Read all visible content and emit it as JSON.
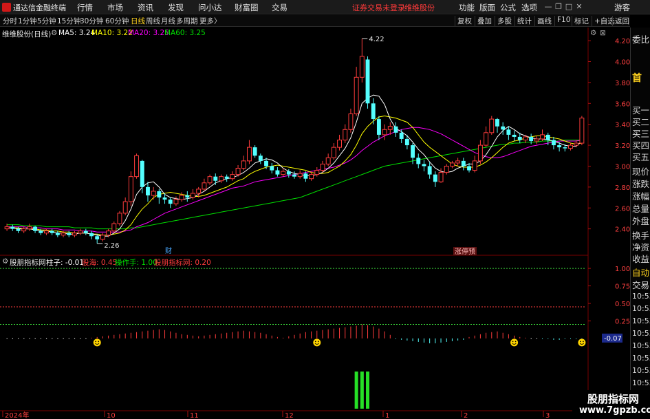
{
  "app": {
    "title": "通达信金融终端"
  },
  "menu": [
    "行情",
    "市场",
    "资讯",
    "发现",
    "问小达",
    "财富圈",
    "交易"
  ],
  "status": {
    "login": "证券交易未登录",
    "stock": "维维股份"
  },
  "top_right": {
    "items": [
      "功能",
      "版面",
      "公式",
      "选项"
    ],
    "guest": "游客"
  },
  "periods": [
    "分时",
    "1分钟",
    "5分钟",
    "15分钟",
    "30分钟",
    "60分钟",
    "日线",
    "周线",
    "月线",
    "多周期",
    "更多〉"
  ],
  "active_period": "日线",
  "toolbar_right": [
    "复权",
    "叠加",
    "多股",
    "统计",
    "画线",
    "F10",
    "标记",
    "+自选",
    "返回"
  ],
  "main_info": {
    "name": "维维股份(日线)",
    "ma5": "MA5: 3.24",
    "ma10": "MA10: 3.22",
    "ma20": "MA20: 3.25",
    "ma60": "MA60: 3.25"
  },
  "indicator_info": {
    "name": "股朋指标网",
    "zhuzi": "柱子: -0.01",
    "guhai": "股海: 0.45",
    "caozuo": "操作手: 1.00",
    "guopeng": "股朋指标网: 0.20"
  },
  "price_axis": [
    "4.20",
    "4.00",
    "3.80",
    "3.60",
    "3.40",
    "3.20",
    "3.00",
    "2.80",
    "2.60",
    "2.40"
  ],
  "indicator_axis": [
    "1.00",
    "0.75",
    "0.50",
    "0.25"
  ],
  "indicator_current": "-0.07",
  "annotations": {
    "high": "4.22",
    "low": "2.26",
    "cai": "财",
    "zhangting": "涨停预"
  },
  "x_axis": [
    "2024年",
    "10",
    "11",
    "12",
    "1",
    "2",
    "3"
  ],
  "right_panel": {
    "items": [
      "委比",
      "首",
      "买一",
      "买二",
      "买三",
      "买四",
      "买五",
      "现价",
      "涨跌",
      "涨幅",
      "总量",
      "外盘",
      "换手",
      "净资",
      "收益",
      "自动",
      "交易"
    ],
    "times": [
      "10:53",
      "10:53",
      "10:53",
      "10:53",
      "10:53",
      "10:53",
      "10:53",
      "10:53",
      "10:53"
    ]
  },
  "watermark": {
    "line1": "股朋指标网",
    "line2": "www.7gpzb.com"
  },
  "colors": {
    "up": "#ff3c3c",
    "down": "#54ffff",
    "ma5": "#ffffff",
    "ma10": "#ffff00",
    "ma20": "#ff00ff",
    "ma60": "#00e000",
    "grid": "#7a0000",
    "smile": "#ffd400"
  },
  "chart_data": {
    "type": "candlestick",
    "price_range": [
      2.26,
      4.22
    ],
    "candles": [
      [
        2.4,
        2.42,
        2.45,
        2.38
      ],
      [
        2.42,
        2.4,
        2.44,
        2.38
      ],
      [
        2.4,
        2.38,
        2.42,
        2.36
      ],
      [
        2.38,
        2.4,
        2.42,
        2.36
      ],
      [
        2.4,
        2.42,
        2.45,
        2.38
      ],
      [
        2.42,
        2.38,
        2.43,
        2.36
      ],
      [
        2.38,
        2.36,
        2.4,
        2.34
      ],
      [
        2.36,
        2.38,
        2.4,
        2.34
      ],
      [
        2.38,
        2.36,
        2.4,
        2.34
      ],
      [
        2.36,
        2.34,
        2.38,
        2.32
      ],
      [
        2.34,
        2.36,
        2.38,
        2.32
      ],
      [
        2.36,
        2.34,
        2.38,
        2.32
      ],
      [
        2.34,
        2.36,
        2.38,
        2.32
      ],
      [
        2.36,
        2.38,
        2.4,
        2.34
      ],
      [
        2.38,
        2.36,
        2.4,
        2.34
      ],
      [
        2.36,
        2.33,
        2.38,
        2.3
      ],
      [
        2.33,
        2.3,
        2.35,
        2.26
      ],
      [
        2.3,
        2.34,
        2.36,
        2.28
      ],
      [
        2.34,
        2.38,
        2.4,
        2.32
      ],
      [
        2.38,
        2.45,
        2.47,
        2.36
      ],
      [
        2.45,
        2.55,
        2.57,
        2.43
      ],
      [
        2.55,
        2.66,
        2.7,
        2.53
      ],
      [
        2.66,
        2.9,
        2.95,
        2.62
      ],
      [
        2.9,
        3.1,
        3.12,
        2.88
      ],
      [
        3.05,
        2.8,
        3.06,
        2.74
      ],
      [
        2.8,
        2.72,
        2.85,
        2.66
      ],
      [
        2.72,
        2.76,
        2.8,
        2.68
      ],
      [
        2.76,
        2.7,
        2.78,
        2.64
      ],
      [
        2.7,
        2.68,
        2.74,
        2.64
      ],
      [
        2.68,
        2.64,
        2.7,
        2.6
      ],
      [
        2.64,
        2.68,
        2.71,
        2.62
      ],
      [
        2.68,
        2.72,
        2.75,
        2.66
      ],
      [
        2.72,
        2.7,
        2.76,
        2.66
      ],
      [
        2.7,
        2.74,
        2.78,
        2.68
      ],
      [
        2.74,
        2.78,
        2.8,
        2.7
      ],
      [
        2.78,
        2.84,
        2.88,
        2.76
      ],
      [
        2.84,
        2.9,
        2.92,
        2.82
      ],
      [
        2.9,
        2.86,
        2.93,
        2.82
      ],
      [
        2.86,
        2.9,
        2.92,
        2.84
      ],
      [
        2.9,
        2.88,
        2.92,
        2.85
      ],
      [
        2.88,
        2.92,
        2.95,
        2.86
      ],
      [
        2.92,
        2.98,
        3.01,
        2.9
      ],
      [
        2.98,
        3.05,
        3.1,
        2.96
      ],
      [
        3.05,
        3.18,
        3.25,
        3.02
      ],
      [
        3.18,
        3.1,
        3.2,
        3.08
      ],
      [
        3.1,
        3.05,
        3.12,
        3.02
      ],
      [
        3.05,
        3.0,
        3.08,
        2.97
      ],
      [
        3.0,
        2.96,
        3.03,
        2.93
      ],
      [
        2.96,
        2.92,
        2.99,
        2.9
      ],
      [
        2.92,
        2.95,
        2.98,
        2.9
      ],
      [
        2.95,
        2.92,
        2.97,
        2.89
      ],
      [
        2.92,
        2.9,
        2.95,
        2.88
      ],
      [
        2.9,
        2.93,
        2.96,
        2.88
      ],
      [
        2.93,
        2.88,
        2.95,
        2.85
      ],
      [
        2.88,
        2.92,
        2.95,
        2.86
      ],
      [
        2.92,
        2.96,
        2.99,
        2.9
      ],
      [
        2.96,
        3.02,
        3.05,
        2.94
      ],
      [
        3.02,
        3.08,
        3.12,
        3.0
      ],
      [
        3.08,
        3.18,
        3.22,
        3.06
      ],
      [
        3.18,
        3.25,
        3.3,
        3.15
      ],
      [
        3.25,
        3.35,
        3.4,
        3.22
      ],
      [
        3.35,
        3.5,
        3.55,
        3.32
      ],
      [
        3.5,
        3.85,
        3.95,
        3.48
      ],
      [
        3.85,
        4.05,
        4.22,
        3.8
      ],
      [
        4.02,
        3.6,
        4.05,
        3.55
      ],
      [
        3.6,
        3.45,
        3.65,
        3.4
      ],
      [
        3.45,
        3.3,
        3.48,
        3.25
      ],
      [
        3.3,
        3.35,
        3.4,
        3.25
      ],
      [
        3.35,
        3.38,
        3.42,
        3.3
      ],
      [
        3.38,
        3.32,
        3.42,
        3.28
      ],
      [
        3.32,
        3.26,
        3.35,
        3.22
      ],
      [
        3.26,
        3.2,
        3.3,
        3.16
      ],
      [
        3.2,
        3.08,
        3.22,
        3.02
      ],
      [
        3.08,
        3.02,
        3.12,
        2.98
      ],
      [
        3.02,
        3.0,
        3.06,
        2.95
      ],
      [
        3.0,
        2.92,
        3.04,
        2.88
      ],
      [
        2.92,
        2.85,
        2.95,
        2.8
      ],
      [
        2.85,
        2.94,
        2.98,
        2.84
      ],
      [
        2.94,
        3.0,
        3.02,
        2.92
      ],
      [
        3.0,
        3.03,
        3.05,
        2.98
      ],
      [
        3.03,
        3.05,
        3.08,
        3.0
      ],
      [
        3.05,
        3.0,
        3.08,
        2.96
      ],
      [
        3.0,
        2.96,
        3.03,
        2.94
      ],
      [
        2.96,
        3.05,
        3.1,
        2.94
      ],
      [
        3.05,
        3.2,
        3.25,
        3.02
      ],
      [
        3.2,
        3.32,
        3.38,
        3.18
      ],
      [
        3.32,
        3.45,
        3.48,
        3.3
      ],
      [
        3.45,
        3.38,
        3.46,
        3.32
      ],
      [
        3.38,
        3.35,
        3.42,
        3.3
      ],
      [
        3.35,
        3.3,
        3.38,
        3.25
      ],
      [
        3.3,
        3.28,
        3.34,
        3.24
      ],
      [
        3.28,
        3.25,
        3.32,
        3.22
      ],
      [
        3.25,
        3.28,
        3.3,
        3.22
      ],
      [
        3.28,
        3.24,
        3.31,
        3.21
      ],
      [
        3.24,
        3.26,
        3.29,
        3.21
      ],
      [
        3.26,
        3.3,
        3.35,
        3.24
      ],
      [
        3.3,
        3.25,
        3.32,
        3.2
      ],
      [
        3.25,
        3.2,
        3.28,
        3.16
      ],
      [
        3.2,
        3.18,
        3.23,
        3.14
      ],
      [
        3.18,
        3.17,
        3.21,
        3.14
      ],
      [
        3.17,
        3.2,
        3.22,
        3.15
      ],
      [
        3.2,
        3.22,
        3.25,
        3.18
      ],
      [
        3.22,
        3.46,
        3.48,
        3.2
      ]
    ],
    "ma5": [
      2.41,
      2.41,
      2.4,
      2.4,
      2.4,
      2.39,
      2.38,
      2.38,
      2.37,
      2.36,
      2.36,
      2.35,
      2.35,
      2.36,
      2.36,
      2.35,
      2.34,
      2.33,
      2.33,
      2.36,
      2.4,
      2.48,
      2.59,
      2.73,
      2.8,
      2.84,
      2.85,
      2.8,
      2.73,
      2.7,
      2.69,
      2.68,
      2.69,
      2.7,
      2.73,
      2.76,
      2.8,
      2.84,
      2.86,
      2.88,
      2.89,
      2.91,
      2.94,
      2.98,
      3.03,
      3.05,
      3.07,
      3.06,
      3.03,
      2.98,
      2.95,
      2.93,
      2.92,
      2.91,
      2.91,
      2.92,
      2.94,
      2.98,
      3.03,
      3.1,
      3.17,
      3.27,
      3.42,
      3.6,
      3.65,
      3.68,
      3.67,
      3.59,
      3.45,
      3.36,
      3.33,
      3.29,
      3.23,
      3.16,
      3.11,
      3.04,
      2.98,
      2.95,
      2.94,
      2.95,
      2.98,
      3.0,
      3.02,
      3.02,
      3.05,
      3.11,
      3.19,
      3.28,
      3.34,
      3.38,
      3.35,
      3.31,
      3.29,
      3.27,
      3.26,
      3.26,
      3.25,
      3.24,
      3.22,
      3.2,
      3.19,
      3.19,
      3.24
    ],
    "ma10": [
      2.41,
      2.41,
      2.41,
      2.4,
      2.4,
      2.4,
      2.39,
      2.39,
      2.38,
      2.38,
      2.37,
      2.37,
      2.36,
      2.36,
      2.36,
      2.35,
      2.35,
      2.34,
      2.34,
      2.35,
      2.36,
      2.39,
      2.44,
      2.52,
      2.59,
      2.64,
      2.7,
      2.73,
      2.74,
      2.75,
      2.74,
      2.73,
      2.72,
      2.71,
      2.71,
      2.72,
      2.74,
      2.76,
      2.78,
      2.8,
      2.83,
      2.86,
      2.88,
      2.92,
      2.95,
      2.97,
      2.99,
      3.0,
      3.01,
      3.0,
      2.99,
      2.98,
      2.97,
      2.96,
      2.94,
      2.93,
      2.93,
      2.94,
      2.97,
      3.0,
      3.05,
      3.11,
      3.2,
      3.31,
      3.38,
      3.43,
      3.47,
      3.48,
      3.47,
      3.46,
      3.44,
      3.42,
      3.37,
      3.3,
      3.23,
      3.18,
      3.14,
      3.1,
      3.06,
      3.02,
      3.0,
      2.99,
      2.99,
      2.99,
      3.01,
      3.04,
      3.08,
      3.13,
      3.18,
      3.22,
      3.24,
      3.25,
      3.27,
      3.28,
      3.29,
      3.29,
      3.28,
      3.27,
      3.26,
      3.24,
      3.22,
      3.21,
      3.22
    ],
    "ma20": [
      2.42,
      2.42,
      2.42,
      2.42,
      2.41,
      2.41,
      2.41,
      2.4,
      2.4,
      2.4,
      2.39,
      2.39,
      2.39,
      2.38,
      2.38,
      2.38,
      2.37,
      2.37,
      2.37,
      2.37,
      2.37,
      2.38,
      2.39,
      2.42,
      2.44,
      2.46,
      2.49,
      2.52,
      2.55,
      2.57,
      2.59,
      2.61,
      2.63,
      2.65,
      2.67,
      2.69,
      2.71,
      2.73,
      2.75,
      2.77,
      2.79,
      2.8,
      2.81,
      2.83,
      2.85,
      2.86,
      2.87,
      2.88,
      2.89,
      2.9,
      2.91,
      2.92,
      2.93,
      2.94,
      2.95,
      2.96,
      2.97,
      2.98,
      2.99,
      3.01,
      3.03,
      3.06,
      3.1,
      3.15,
      3.19,
      3.23,
      3.26,
      3.29,
      3.31,
      3.33,
      3.35,
      3.36,
      3.37,
      3.37,
      3.36,
      3.35,
      3.33,
      3.31,
      3.28,
      3.25,
      3.22,
      3.19,
      3.16,
      3.13,
      3.11,
      3.09,
      3.08,
      3.08,
      3.09,
      3.11,
      3.13,
      3.15,
      3.17,
      3.19,
      3.2,
      3.21,
      3.22,
      3.23,
      3.24,
      3.24,
      3.24,
      3.24,
      3.25
    ],
    "ma60": [
      2.44,
      2.44,
      2.44,
      2.43,
      2.43,
      2.43,
      2.43,
      2.42,
      2.42,
      2.42,
      2.42,
      2.42,
      2.41,
      2.41,
      2.41,
      2.41,
      2.4,
      2.4,
      2.4,
      2.4,
      2.4,
      2.4,
      2.41,
      2.41,
      2.42,
      2.43,
      2.44,
      2.45,
      2.46,
      2.47,
      2.48,
      2.49,
      2.5,
      2.51,
      2.52,
      2.53,
      2.54,
      2.55,
      2.56,
      2.57,
      2.58,
      2.59,
      2.6,
      2.61,
      2.62,
      2.63,
      2.64,
      2.65,
      2.66,
      2.67,
      2.68,
      2.69,
      2.7,
      2.72,
      2.74,
      2.76,
      2.78,
      2.8,
      2.82,
      2.84,
      2.86,
      2.88,
      2.9,
      2.92,
      2.94,
      2.96,
      2.98,
      3.0,
      3.01,
      3.02,
      3.03,
      3.04,
      3.05,
      3.06,
      3.07,
      3.08,
      3.09,
      3.1,
      3.11,
      3.12,
      3.13,
      3.14,
      3.15,
      3.16,
      3.17,
      3.18,
      3.19,
      3.2,
      3.21,
      3.21,
      3.22,
      3.22,
      3.23,
      3.23,
      3.23,
      3.24,
      3.24,
      3.24,
      3.24,
      3.25,
      3.25,
      3.25,
      3.25
    ],
    "indicator": {
      "range": [
        -0.07,
        1.0
      ],
      "levels": [
        1.0,
        0.45,
        0.2
      ],
      "columns": [
        0,
        0,
        0,
        0,
        0,
        0,
        0,
        0,
        0,
        0,
        0,
        0,
        0,
        0,
        0,
        0.01,
        0.02,
        0.03,
        0.04,
        0.05,
        0.06,
        0.07,
        0.08,
        0.09,
        0.1,
        0.11,
        0.12,
        0.13,
        0.12,
        0.1,
        0.08,
        0.06,
        0.05,
        0.04,
        0.03,
        0.04,
        0.05,
        0.06,
        0.07,
        0.08,
        0.09,
        0.1,
        0.11,
        0.1,
        0.09,
        0.08,
        0.06,
        0.04,
        0.02,
        0.01,
        0.03,
        0.05,
        0.07,
        0.09,
        0.1,
        0.11,
        0.12,
        0.13,
        0.14,
        0.15,
        0.16,
        0.17,
        0.18,
        0.2,
        0.19,
        0.17,
        0.14,
        0.1,
        0.05,
        -0.01,
        -0.02,
        -0.03,
        -0.04,
        -0.05,
        -0.06,
        -0.07,
        -0.07,
        -0.06,
        -0.05,
        -0.04,
        -0.03,
        -0.02,
        0.02,
        0.04,
        0.06,
        0.08,
        0.09,
        0.1,
        0.08,
        0.06,
        0.04,
        0.02,
        0.01,
        0,
        0,
        -0.01,
        -0.01,
        -0.02,
        -0.02,
        -0.01,
        -0.01,
        -0.01,
        -0.01
      ],
      "signal_bars": [
        62,
        63,
        64
      ],
      "smile_indices": [
        16,
        55,
        90,
        106
      ]
    }
  }
}
